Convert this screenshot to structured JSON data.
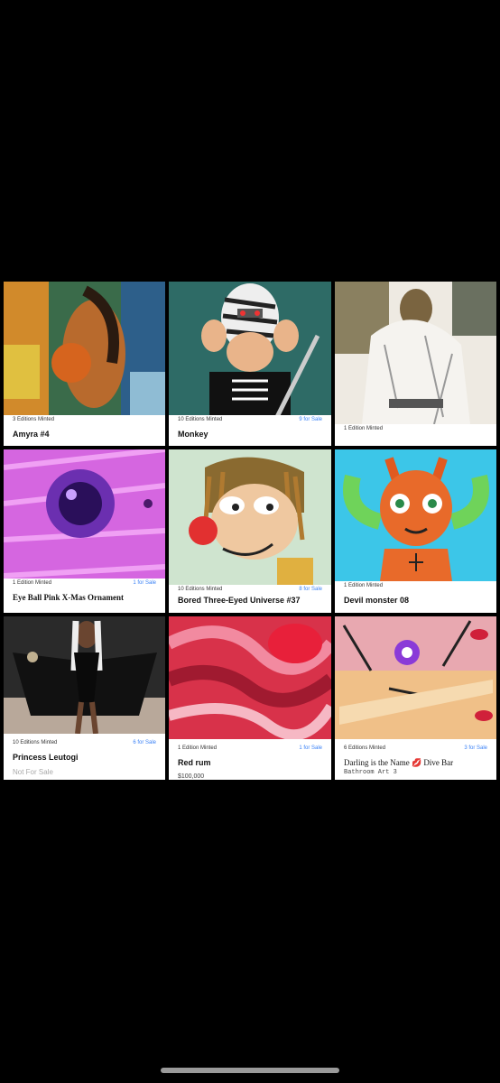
{
  "cards": [
    {
      "editions": "3 Editions Minted",
      "sale": "",
      "title": "Amyra #4",
      "sub": ""
    },
    {
      "editions": "10 Editions Minted",
      "sale": "9 for Sale",
      "title": "Monkey",
      "sub": ""
    },
    {
      "editions": "1 Edition Minted",
      "sale": "",
      "title": "",
      "sub": ""
    },
    {
      "editions": "1 Edition Minted",
      "sale": "1 for Sale",
      "title": "Eye Ball Pink X-Mas Ornament",
      "sub": ""
    },
    {
      "editions": "10 Editions Minted",
      "sale": "8 for Sale",
      "title": "Bored Three-Eyed Universe #37",
      "sub": ""
    },
    {
      "editions": "1 Edition Minted",
      "sale": "",
      "title": "Devil monster 08",
      "sub": ""
    },
    {
      "editions": "10 Editions Minted",
      "sale": "6 for Sale",
      "title": "Princess Leutogi",
      "sub": "Not For Sale"
    },
    {
      "editions": "1 Edition Minted",
      "sale": "1 for Sale",
      "title": "Red rum",
      "sub": "$100,000"
    },
    {
      "editions": "6 Editions Minted",
      "sale": "3 for Sale",
      "title": "Darling is the Name 💋 Dive Bar",
      "sub": "Bathroom Art 3"
    }
  ],
  "art_icons": [
    "painting-woman-basketball",
    "zebra-monkey-skeleton",
    "mona-lisa-white-paint",
    "pink-eyeball-ornament",
    "cartoon-three-eyed-character",
    "orange-devil-monster",
    "woman-in-black-costume",
    "red-swirl-abstract",
    "darling-graffiti-art"
  ]
}
